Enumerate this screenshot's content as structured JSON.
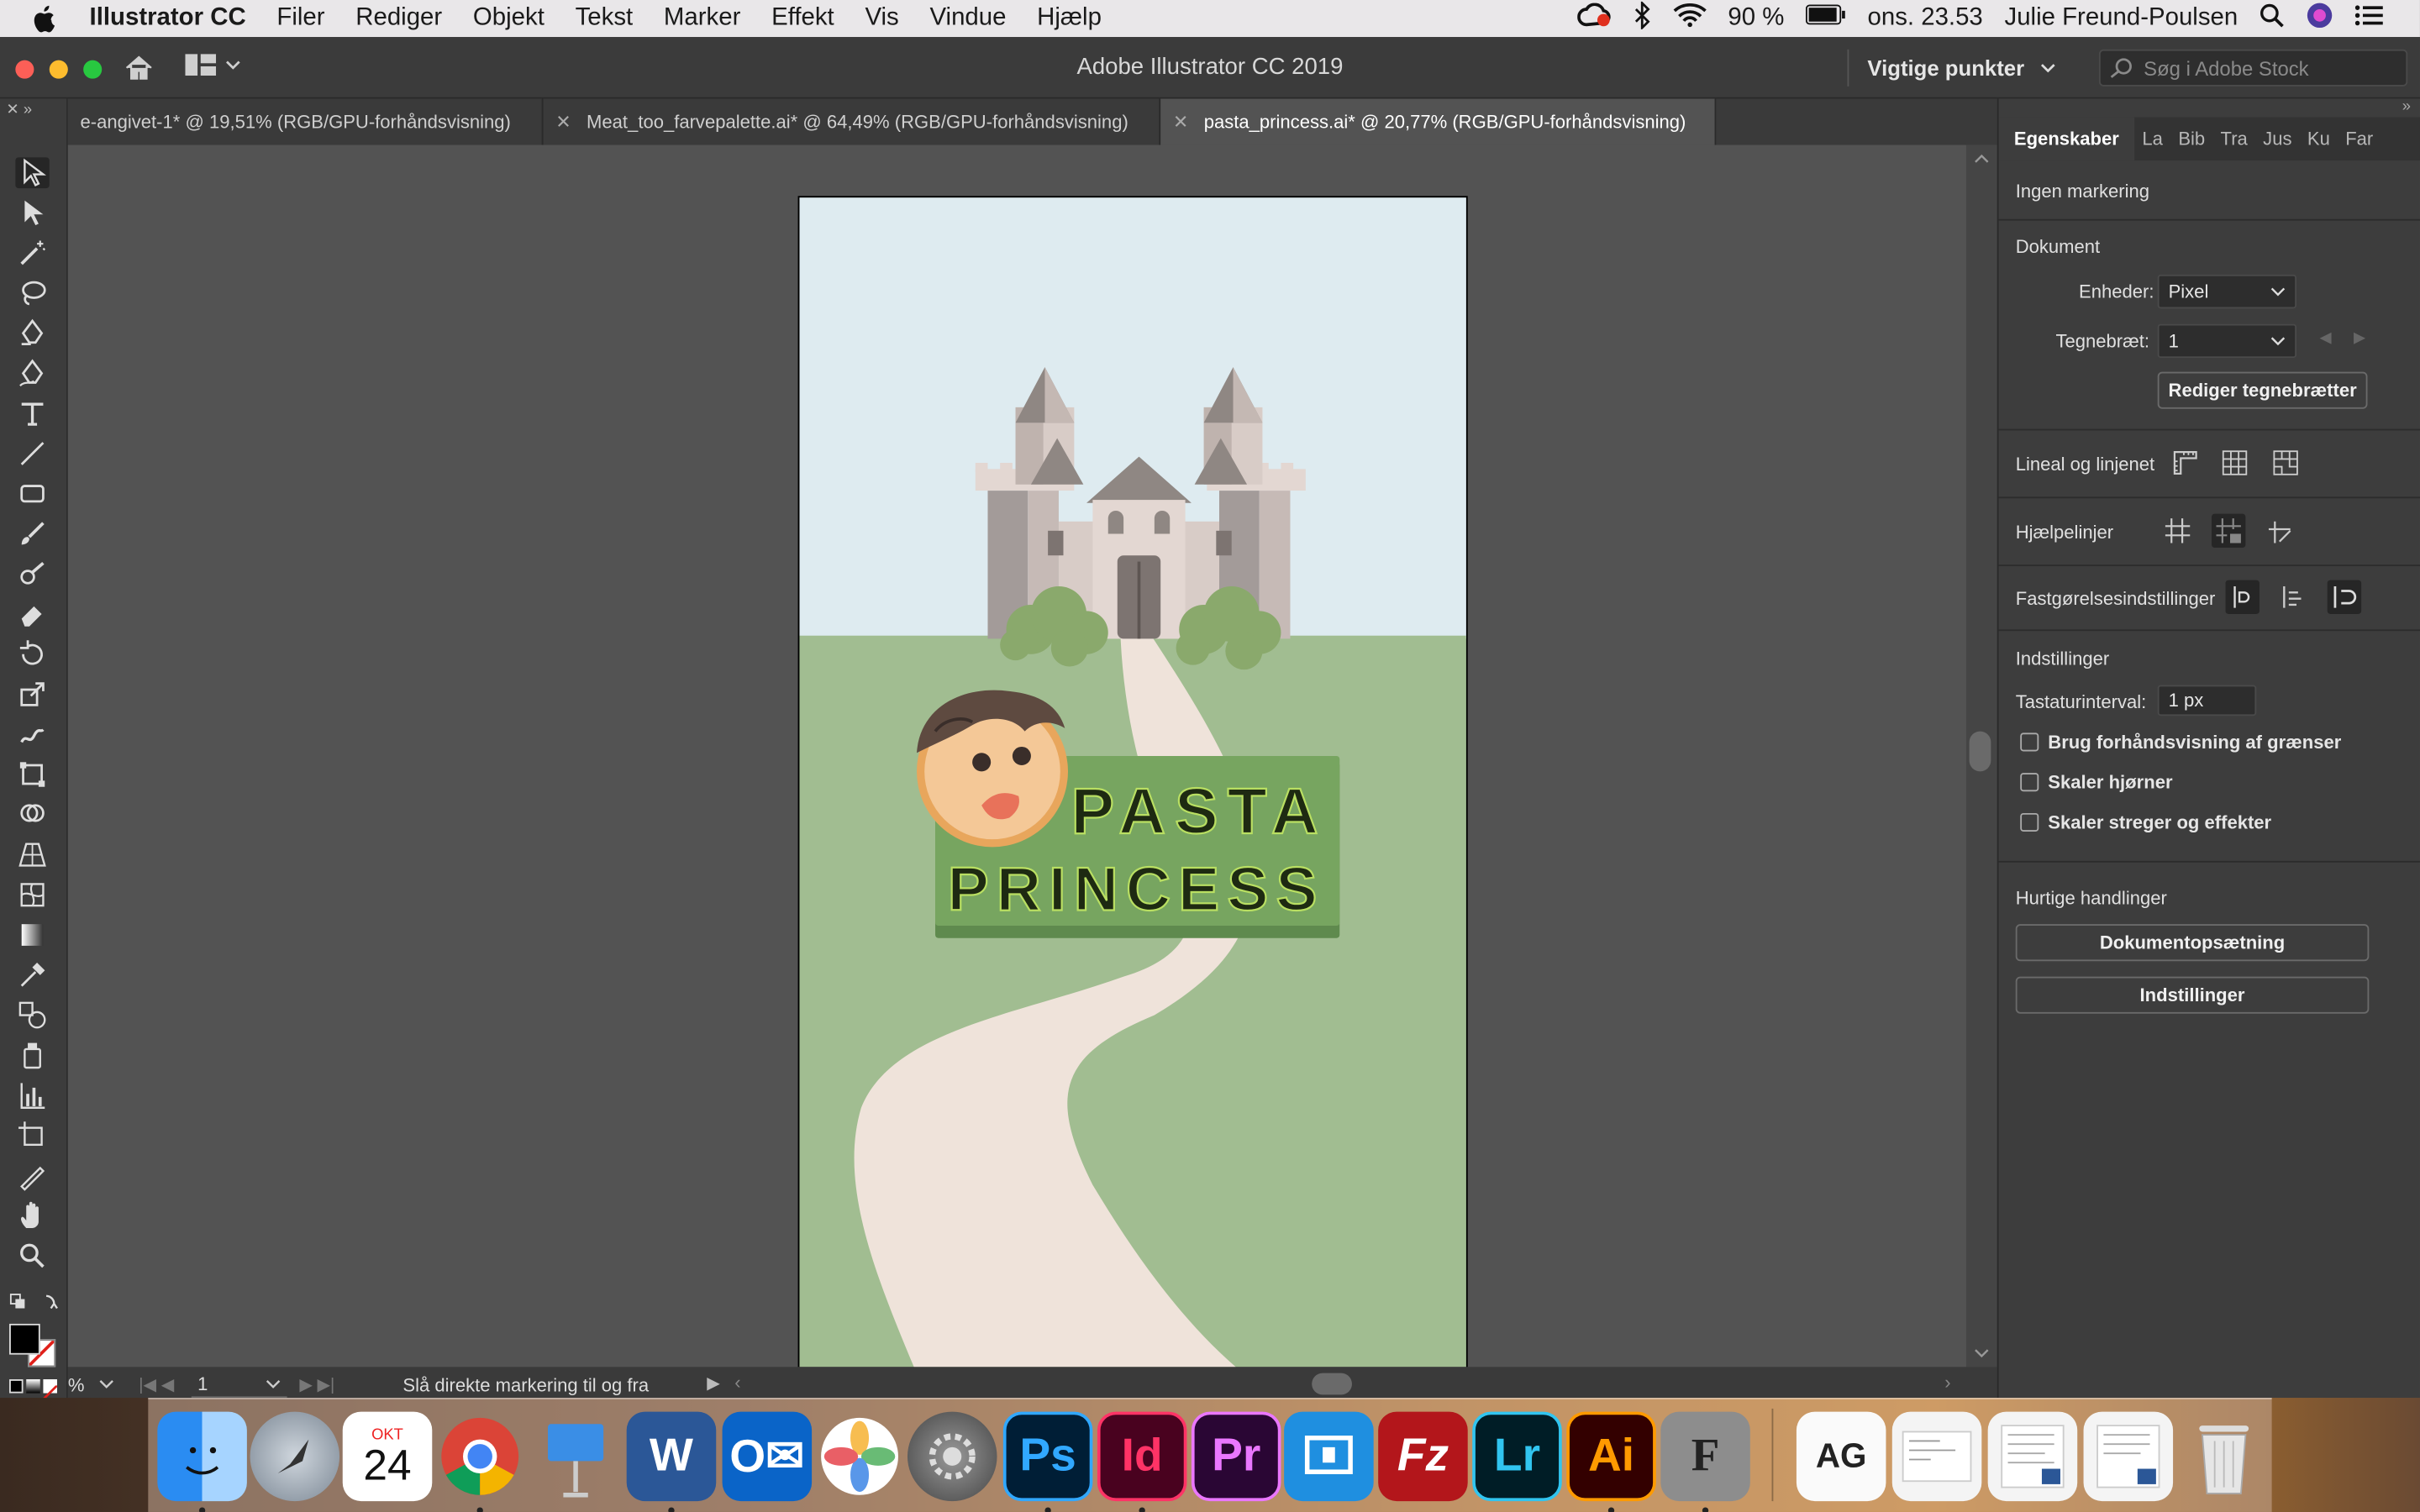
{
  "menubar": {
    "app": "Illustrator CC",
    "items": [
      "Filer",
      "Rediger",
      "Objekt",
      "Tekst",
      "Marker",
      "Effekt",
      "Vis",
      "Vindue",
      "Hjælp"
    ],
    "battery": "90 %",
    "clock": "ons. 23.53",
    "user": "Julie Freund-Poulsen"
  },
  "window": {
    "title": "Adobe Illustrator CC 2019",
    "workspace": "Vigtige punkter",
    "stock_placeholder": "Søg i Adobe Stock"
  },
  "tabs": [
    {
      "label": "e-angivet-1* @ 19,51% (RGB/GPU-forhåndsvisning)"
    },
    {
      "label": "Meat_too_farvepalette.ai* @ 64,49% (RGB/GPU-forhåndsvisning)"
    },
    {
      "label": "pasta_princess.ai* @ 20,77% (RGB/GPU-forhåndsvisning)"
    }
  ],
  "artwork": {
    "line1": "PASTA",
    "line2": "PRINCESS"
  },
  "status": {
    "zoom": "%",
    "artboard": "1",
    "message": "Slå direkte markering til og fra"
  },
  "panel": {
    "tabs": [
      "Egenskaber",
      "La",
      "Bib",
      "Tra",
      "Jus",
      "Ku",
      "Far"
    ],
    "no_selection": "Ingen markering",
    "document": "Dokument",
    "units_label": "Enheder:",
    "units_value": "Pixel",
    "artboard_label": "Tegnebræt:",
    "artboard_value": "1",
    "edit_artboards": "Rediger tegnebrætter",
    "rulers": "Lineal og linjenet",
    "guides": "Hjælpelinjer",
    "snap": "Fastgørelsesindstillinger",
    "prefs": "Indstillinger",
    "keyboard_label": "Tastaturinterval:",
    "keyboard_value": "1 px",
    "cb1": "Brug forhåndsvisning af grænser",
    "cb2": "Skaler hjørner",
    "cb3": "Skaler streger og effekter",
    "quick": "Hurtige handlinger",
    "doc_setup": "Dokumentopsætning",
    "prefs_btn": "Indstillinger"
  },
  "dock": {
    "calendar_month": "OKT",
    "calendar_day": "24"
  }
}
